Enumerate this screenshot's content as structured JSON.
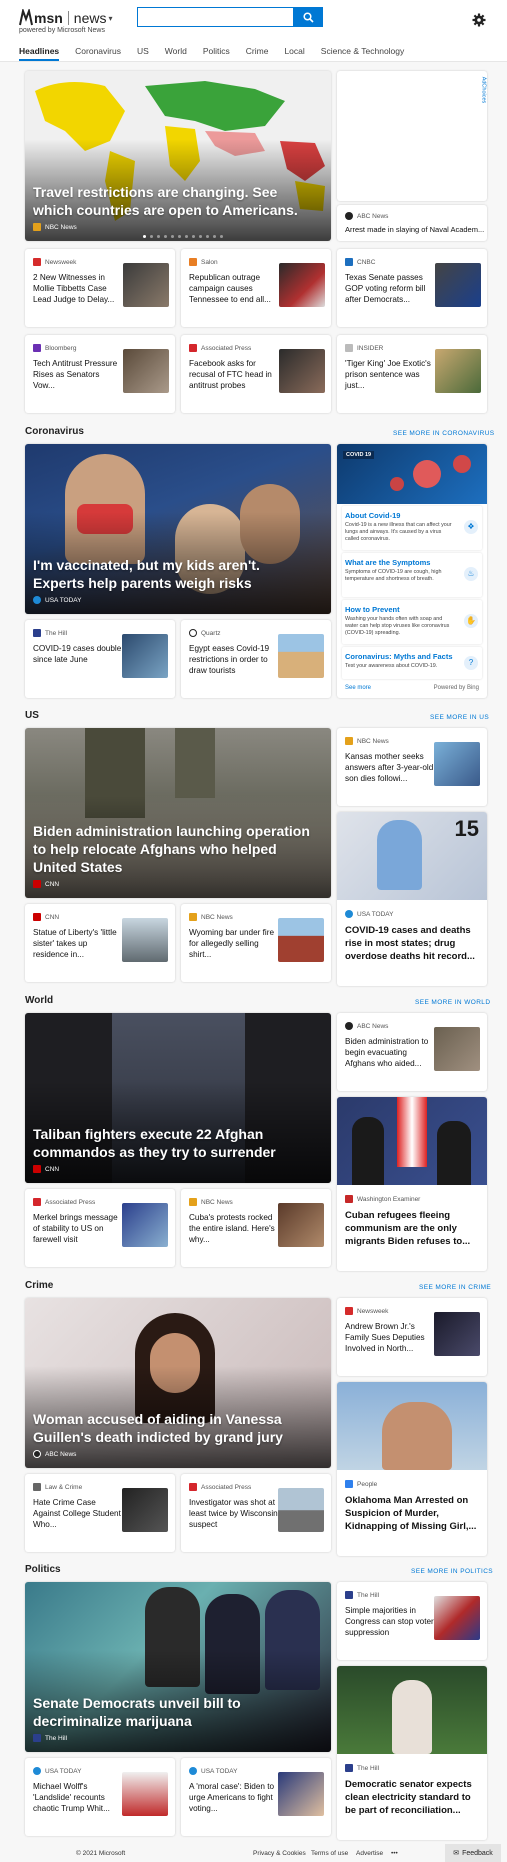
{
  "header": {
    "brand": "msn",
    "product": "news",
    "powered": "powered by Microsoft News",
    "search_placeholder": "",
    "settings_icon": "gear-icon"
  },
  "tabs": [
    "Headlines",
    "Coronavirus",
    "US",
    "World",
    "Politics",
    "Crime",
    "Local",
    "Science & Technology"
  ],
  "active_tab": "Headlines",
  "headlines": {
    "hero": {
      "title": "Travel restrictions are changing. See which countries are open to Americans.",
      "source": "NBC News"
    },
    "ad_label": "AdChoices",
    "side": {
      "source": "ABC News",
      "title": "Arrest made in slaying of Naval Academ..."
    },
    "row1": [
      {
        "source": "Newsweek",
        "title": "2 New Witnesses in Mollie Tibbetts Case Lead Judge to Delay..."
      },
      {
        "source": "Salon",
        "title": "Republican outrage campaign causes Tennessee to end all..."
      },
      {
        "source": "CNBC",
        "title": "Texas Senate passes GOP voting reform bill after Democrats..."
      }
    ],
    "row2": [
      {
        "source": "Bloomberg",
        "title": "Tech Antitrust Pressure Rises as Senators Vow..."
      },
      {
        "source": "Associated Press",
        "title": "Facebook asks for recusal of FTC head in antitrust probes"
      },
      {
        "source": "INSIDER",
        "title": "'Tiger King' Joe Exotic's prison sentence was just..."
      }
    ]
  },
  "coronavirus": {
    "heading": "Coronavirus",
    "see_more": "SEE MORE IN CORONAVIRUS",
    "hero": {
      "title": "I'm vaccinated, but my kids aren't. Experts help parents weigh risks",
      "source": "USA TODAY"
    },
    "widget": {
      "badge": "COVID 19",
      "items": [
        {
          "title": "About Covid-19",
          "body": "Covid-19 is a new illness that can affect your lungs and airways. It's caused by a virus called coronavirus."
        },
        {
          "title": "What are the Symptoms",
          "body": "Symptoms of COVID-19 are cough, high temperature and shortness of breath."
        },
        {
          "title": "How to Prevent",
          "body": "Washing your hands often with soap and water can help stop viruses like coronavirus (COVID-19) spreading."
        },
        {
          "title": "Coronavirus: Myths and Facts",
          "body": "Test your awareness about COVID-19."
        }
      ],
      "see_more": "See more",
      "powered": "Powered by Bing"
    },
    "row": [
      {
        "source": "The Hill",
        "title": "COVID-19 cases double since late June"
      },
      {
        "source": "Quartz",
        "title": "Egypt eases Covid-19 restrictions in order to draw tourists"
      }
    ]
  },
  "us": {
    "heading": "US",
    "see_more": "SEE MORE IN US",
    "hero": {
      "title": "Biden administration launching operation to help relocate Afghans who helped United States",
      "source": "CNN"
    },
    "side": {
      "source": "NBC News",
      "title": "Kansas mother seeks answers after 3-year-old son dies followi..."
    },
    "side2": {
      "source": "USA TODAY",
      "title": "COVID-19 cases and deaths rise in most states; drug overdose deaths hit record..."
    },
    "row": [
      {
        "source": "CNN",
        "title": "Statue of Liberty's 'little sister' takes up residence in..."
      },
      {
        "source": "NBC News",
        "title": "Wyoming bar under fire for allegedly selling shirt..."
      }
    ]
  },
  "world": {
    "heading": "World",
    "see_more": "SEE MORE IN WORLD",
    "hero": {
      "title": "Taliban fighters execute 22 Afghan commandos as they try to surrender",
      "source": "CNN"
    },
    "side": {
      "source": "ABC News",
      "title": "Biden administration to begin evacuating Afghans who aided..."
    },
    "side2": {
      "source": "Washington Examiner",
      "title": "Cuban refugees fleeing communism are the only migrants Biden refuses to..."
    },
    "row": [
      {
        "source": "Associated Press",
        "title": "Merkel brings message of stability to US on farewell visit"
      },
      {
        "source": "NBC News",
        "title": "Cuba's protests rocked the entire island. Here's why..."
      }
    ]
  },
  "crime": {
    "heading": "Crime",
    "see_more": "SEE MORE IN CRIME",
    "hero": {
      "title": "Woman accused of aiding in Vanessa Guillen's death indicted by grand jury",
      "source": "ABC News"
    },
    "side": {
      "source": "Newsweek",
      "title": "Andrew Brown Jr.'s Family Sues Deputies Involved in North..."
    },
    "side2": {
      "source": "People",
      "title": "Oklahoma Man Arrested on Suspicion of Murder, Kidnapping of Missing Girl,..."
    },
    "row": [
      {
        "source": "Law & Crime",
        "title": "Hate Crime Case Against College Student Who..."
      },
      {
        "source": "Associated Press",
        "title": "Investigator was shot at least twice by Wisconsin suspect"
      }
    ]
  },
  "politics": {
    "heading": "Politics",
    "see_more": "SEE MORE IN POLITICS",
    "hero": {
      "title": "Senate Democrats unveil bill to decriminalize marijuana",
      "source": "The Hill"
    },
    "side": {
      "source": "The Hill",
      "title": "Simple majorities in Congress can stop voter suppression"
    },
    "side2": {
      "source": "The Hill",
      "title": "Democratic senator expects clean electricity standard to be part of reconciliation..."
    },
    "row": [
      {
        "source": "USA TODAY",
        "title": "Michael Wolff's 'Landslide' recounts chaotic Trump Whit..."
      },
      {
        "source": "USA TODAY",
        "title": "A 'moral case': Biden to urge Americans to fight voting..."
      }
    ]
  },
  "footer": {
    "copyright": "© 2021 Microsoft",
    "privacy": "Privacy & Cookies",
    "terms": "Terms of use",
    "advertise": "Advertise",
    "more": "•••",
    "feedback": "Feedback"
  }
}
